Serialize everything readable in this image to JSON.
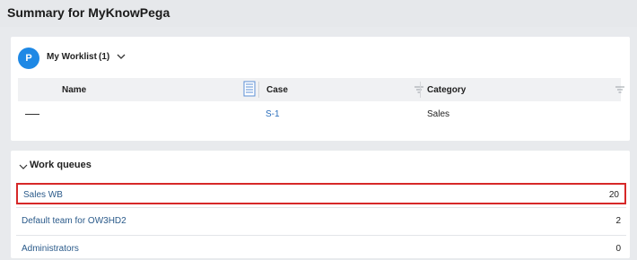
{
  "page": {
    "title": "Summary for MyKnowPega"
  },
  "worklist": {
    "avatar_letter": "P",
    "title": "My Worklist",
    "count": "(1)",
    "columns": {
      "name": "Name",
      "case": "Case",
      "category": "Category"
    },
    "rows": [
      {
        "name": "",
        "case": "S-1",
        "category": "Sales"
      }
    ]
  },
  "work_queues": {
    "title": "Work queues",
    "items": [
      {
        "name": "Sales WB",
        "count": "20",
        "highlighted": true
      },
      {
        "name": "Default team for OW3HD2",
        "count": "2",
        "highlighted": false
      },
      {
        "name": "Administrators",
        "count": "0",
        "highlighted": false
      }
    ]
  },
  "colors": {
    "accent": "#1e88e5",
    "link": "#2a6ebb",
    "highlight_border": "#d62828"
  },
  "icons": {
    "avatar": "avatar",
    "worklist_toggle": "chevron-down-icon",
    "name_column": "notes-icon",
    "column_filter": "filter-icon",
    "queues_toggle": "chevron-down-icon"
  }
}
